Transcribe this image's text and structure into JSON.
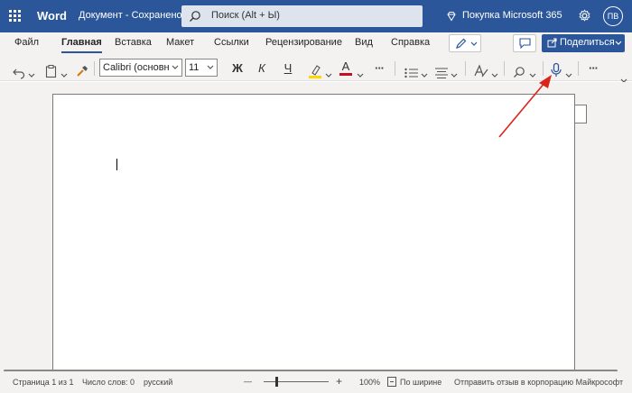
{
  "titlebar": {
    "app_name": "Word",
    "doc_title": "Документ - Сохранено в",
    "search_placeholder": "Поиск (Alt + Ы)",
    "buy_label": "Покупка Microsoft 365",
    "avatar_initials": "ПВ"
  },
  "tabs": [
    "Файл",
    "Главная",
    "Вставка",
    "Макет",
    "Ссылки",
    "Рецензирование",
    "Вид",
    "Справка"
  ],
  "active_tab": "Главная",
  "share_label": "Поделиться",
  "ribbon": {
    "font_name": "Calibri (основн",
    "font_size": "11",
    "bold": "Ж",
    "italic": "К",
    "underline": "Ч",
    "font_color_letter": "A",
    "more": "···"
  },
  "colors": {
    "brand": "#2b579a",
    "highlight": "#ffd700",
    "font_color": "#c50f1f",
    "annotation": "#d9261c"
  },
  "status": {
    "page": "Страница 1 из 1",
    "words": "Число слов: 0",
    "language": "русский",
    "zoom_minus": "—",
    "zoom_plus": "+",
    "zoom_level": "100%",
    "fit": "По ширине",
    "feedback": "Отправить отзыв в корпорацию Майкрософт"
  }
}
